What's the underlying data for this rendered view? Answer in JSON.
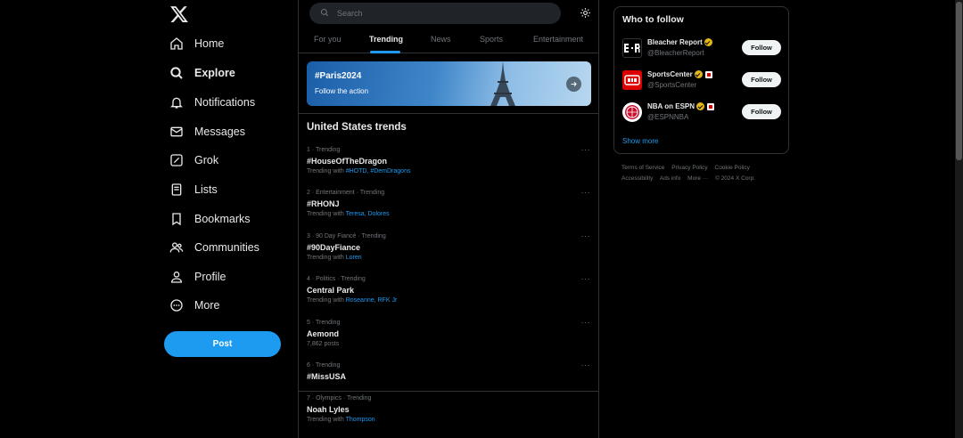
{
  "nav": {
    "items": [
      {
        "label": "Home",
        "icon": "home-icon"
      },
      {
        "label": "Explore",
        "icon": "search-icon",
        "active": true
      },
      {
        "label": "Notifications",
        "icon": "bell-icon"
      },
      {
        "label": "Messages",
        "icon": "envelope-icon"
      },
      {
        "label": "Grok",
        "icon": "grok-icon"
      },
      {
        "label": "Lists",
        "icon": "list-icon"
      },
      {
        "label": "Bookmarks",
        "icon": "bookmark-icon"
      },
      {
        "label": "Communities",
        "icon": "people-icon"
      },
      {
        "label": "Profile",
        "icon": "person-icon"
      },
      {
        "label": "More",
        "icon": "more-circle-icon"
      }
    ],
    "post_label": "Post"
  },
  "search": {
    "placeholder": "Search"
  },
  "tabs": [
    {
      "label": "For you"
    },
    {
      "label": "Trending",
      "active": true
    },
    {
      "label": "News"
    },
    {
      "label": "Sports"
    },
    {
      "label": "Entertainment"
    }
  ],
  "banner": {
    "title": "#Paris2024",
    "subtitle": "Follow the action"
  },
  "trends_title": "United States trends",
  "trends": [
    {
      "meta": "1 · Trending",
      "name": "#HouseOfTheDragon",
      "sub_prefix": "Trending with",
      "sub_links": "#HOTD, #DemDragons"
    },
    {
      "meta": "2 · Entertainment · Trending",
      "name": "#RHONJ",
      "sub_prefix": "Trending with",
      "sub_links": "Teresa, Dolores"
    },
    {
      "meta": "3 · 90 Day Fiancé · Trending",
      "name": "#90DayFiance",
      "sub_prefix": "Trending with",
      "sub_links": "Loren"
    },
    {
      "meta": "4 · Politics · Trending",
      "name": "Central Park",
      "sub_prefix": "Trending with",
      "sub_links": "Roseanne, RFK Jr"
    },
    {
      "meta": "5 · Trending",
      "name": "Aemond",
      "sub_prefix": "7,862 posts",
      "sub_links": ""
    },
    {
      "meta": "6 · Trending",
      "name": "#MissUSA",
      "sub_prefix": "",
      "sub_links": ""
    },
    {
      "meta": "7 · Olympics · Trending",
      "name": "Noah Lyles",
      "sub_prefix": "Trending with",
      "sub_links": "Thompson"
    }
  ],
  "who_to_follow": {
    "title": "Who to follow",
    "accounts": [
      {
        "name": "Bleacher Report",
        "handle": "@BleacherReport",
        "follow_label": "Follow"
      },
      {
        "name": "SportsCenter",
        "handle": "@SportsCenter",
        "follow_label": "Follow"
      },
      {
        "name": "NBA on ESPN",
        "handle": "@ESPNNBA",
        "follow_label": "Follow"
      }
    ],
    "show_more": "Show more"
  },
  "footer": {
    "links": [
      "Terms of Service",
      "Privacy Policy",
      "Cookie Policy",
      "Accessibility",
      "Ads info",
      "More ···",
      "© 2024 X Corp."
    ]
  },
  "colors": {
    "accent": "#1d9bf0",
    "background": "#000000",
    "border": "#2f3336",
    "muted": "#71767b",
    "verified": "#e2b719"
  }
}
